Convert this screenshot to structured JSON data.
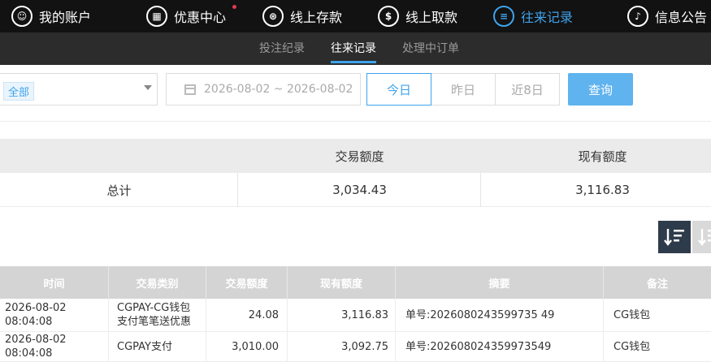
{
  "nav": {
    "items": [
      {
        "label": "我的账户",
        "icon": "user-icon",
        "glyph": "☺"
      },
      {
        "label": "优惠中心",
        "icon": "gift-icon",
        "glyph": "▦"
      },
      {
        "label": "线上存款",
        "icon": "deposit-icon",
        "glyph": "⊛"
      },
      {
        "label": "线上取款",
        "icon": "withdraw-icon",
        "glyph": "$"
      },
      {
        "label": "往来记录",
        "icon": "records-icon",
        "glyph": "≡"
      },
      {
        "label": "信息公告",
        "icon": "bell-icon",
        "glyph": "♪"
      }
    ],
    "active_index": 4,
    "badge_color": "#e23b4b"
  },
  "subnav": {
    "items": [
      "投注纪录",
      "往来记录",
      "处理中订单"
    ],
    "active_index": 1
  },
  "filters": {
    "type_value": "全部",
    "date_range": "2026-08-02 ~ 2026-08-02",
    "ranges": [
      "今日",
      "昨日",
      "近8日"
    ],
    "active_range": 0,
    "query_label": "查询"
  },
  "summary": {
    "headers": [
      "",
      "交易额度",
      "现有额度"
    ],
    "row": {
      "label": "总计",
      "transaction": "3,034.43",
      "balance": "3,116.83"
    }
  },
  "table": {
    "headers": [
      "时间",
      "交易类别",
      "交易额度",
      "现有额度",
      "摘要",
      "备注"
    ],
    "rows": [
      {
        "time": "2026-08-02 08:04:08",
        "type": "CGPAY-CG钱包支付笔笔送优惠",
        "amount": "24.08",
        "balance": "3,116.83",
        "summary": "单号:2026080243599735 49",
        "note": "CG钱包"
      },
      {
        "time": "2026-08-02 08:04:08",
        "type": "CGPAY支付",
        "amount": "3,010.00",
        "balance": "3,092.75",
        "summary": "单号:202608024359973549",
        "note": "CG钱包"
      }
    ]
  },
  "colors": {
    "accent": "#3ea3ec",
    "topbar": "#121212",
    "subbar": "#2c2c2c"
  }
}
